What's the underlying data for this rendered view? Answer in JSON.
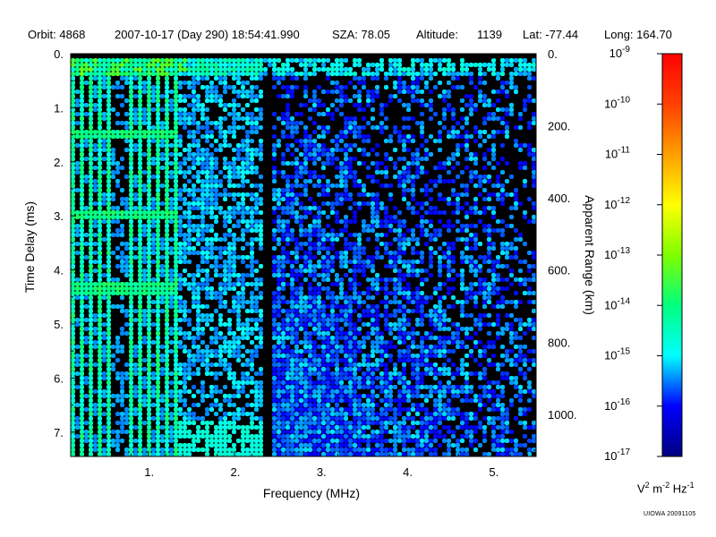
{
  "header": {
    "orbit": "Orbit: 4868",
    "datetime": "2007-10-17 (Day 290) 18:54:41.990",
    "sza": "SZA:  78.05",
    "altitude_label": "Altitude:",
    "altitude_value": "1139",
    "lat": "Lat: -77.44",
    "long": "Long: 164.70"
  },
  "chart_data": {
    "type": "heatmap",
    "description_of_axes": "ionogram",
    "xlabel": "Frequency (MHz)",
    "ylabel": "Time Delay (ms)",
    "y2label": "Apparent Range (km)",
    "xlim": [
      0.1,
      5.5
    ],
    "ylim": [
      0,
      7.45
    ],
    "x_ticks": [
      {
        "value": 1,
        "label": "1."
      },
      {
        "value": 2,
        "label": "2."
      },
      {
        "value": 3,
        "label": "3."
      },
      {
        "value": 4,
        "label": "4."
      },
      {
        "value": 5,
        "label": "5."
      }
    ],
    "y_ticks": [
      {
        "value": 0,
        "label": "0."
      },
      {
        "value": 1,
        "label": "1."
      },
      {
        "value": 2,
        "label": "2."
      },
      {
        "value": 3,
        "label": "3."
      },
      {
        "value": 4,
        "label": "4."
      },
      {
        "value": 5,
        "label": "5."
      },
      {
        "value": 6,
        "label": "6."
      },
      {
        "value": 7,
        "label": "7."
      }
    ],
    "y2_ticks": [
      {
        "value": 0,
        "label": "0."
      },
      {
        "value": 200,
        "label": "200."
      },
      {
        "value": 400,
        "label": "400."
      },
      {
        "value": 600,
        "label": "600."
      },
      {
        "value": 800,
        "label": "800."
      },
      {
        "value": 1000,
        "label": "1000."
      }
    ],
    "y2lim": [
      0,
      1117
    ],
    "colorbar": {
      "scale": "log",
      "min_exp": -17,
      "max_exp": -9,
      "ticks": [
        {
          "base": "10",
          "exp": "-9"
        },
        {
          "base": "10",
          "exp": "-10"
        },
        {
          "base": "10",
          "exp": "-11"
        },
        {
          "base": "10",
          "exp": "-12"
        },
        {
          "base": "10",
          "exp": "-13"
        },
        {
          "base": "10",
          "exp": "-14"
        },
        {
          "base": "10",
          "exp": "-15"
        },
        {
          "base": "10",
          "exp": "-16"
        },
        {
          "base": "10",
          "exp": "-17"
        }
      ],
      "unit_parts": [
        "V",
        "2",
        " m",
        "-2",
        " Hz",
        "-1"
      ]
    },
    "features": {
      "surface_reflection_delay_ms": 0.25,
      "plasma_line_harmonic_spacing_mhz": 0.1,
      "strong_noise_band_mhz": [
        0.1,
        1.35
      ],
      "moderate_noise_band_mhz": [
        1.35,
        2.35
      ],
      "quiet_gap_mhz": [
        2.35,
        2.45
      ],
      "weak_noise_band_mhz": [
        2.45,
        5.5
      ],
      "electron_cyclotron_echo_delays_ms": [
        1.5,
        2.95,
        4.35
      ]
    }
  },
  "credit": "UIOWA 20091105"
}
